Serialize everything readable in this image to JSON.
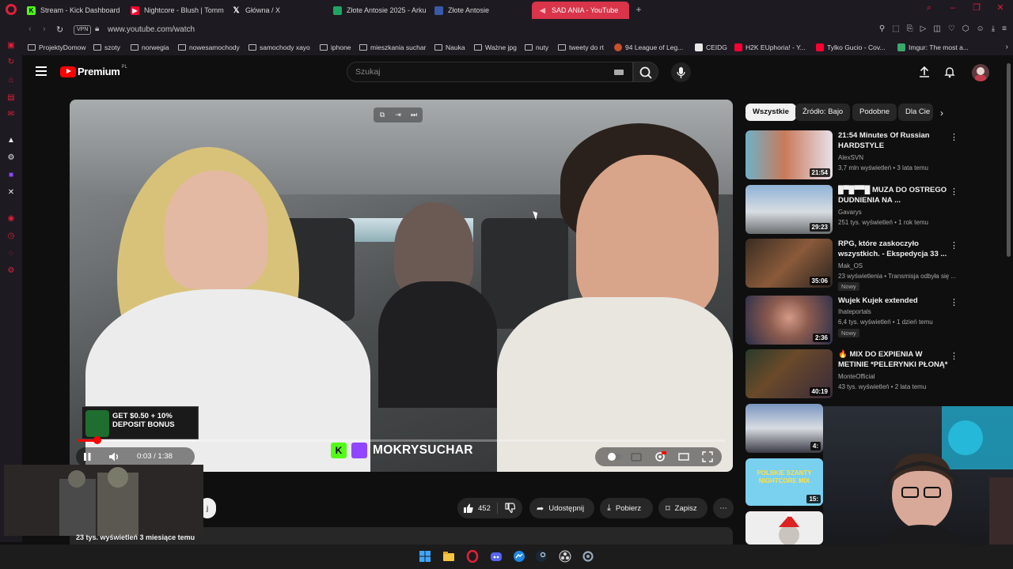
{
  "browser": {
    "tabs": [
      {
        "label": "Stream - Kick Dashboard",
        "favicon_color": "#53fc18"
      },
      {
        "label": "Nightcore - Blush | Tomm",
        "favicon_color": "#ff0033"
      },
      {
        "label": "Główna / X",
        "favicon_color": "#000000"
      },
      {
        "label": "Złote Antosie 2025 - Arku",
        "favicon_color": "#1fa463"
      },
      {
        "label": "Złote Antosie",
        "favicon_color": "#3a5aa8"
      },
      {
        "label": "SAD ANIA - YouTube",
        "favicon_color": "#ff0033"
      }
    ],
    "vpn_label": "VPN",
    "url": "www.youtube.com/watch",
    "bookmarks": [
      "ProjektyDomow",
      "szoty",
      "norwegia",
      "nowesamochody",
      "samochody xayo",
      "iphone",
      "mieszkania suchar",
      "Nauka",
      "Ważne jpg",
      "nuty",
      "tweety do rt",
      "94 League of Leg...",
      "CEIDG",
      "H2K EUphoria! - Y...",
      "Tylko Gucio - Cov...",
      "Imgur: The most a..."
    ]
  },
  "youtube": {
    "logo_text": "Premium",
    "logo_region": "PL",
    "search_placeholder": "Szukaj",
    "player": {
      "time": "0:03 / 1:38",
      "progress_fraction": 0.03,
      "watermark": "MOKRYSUCHAR",
      "ad_line1": "GET $0.50 + 10%",
      "ad_line2": "DEPOSIT BONUS"
    },
    "actions": {
      "likes": "452",
      "share": "Udostępnij",
      "download": "Pobierz",
      "save": "Zapisz",
      "subscribe_partial": "j"
    },
    "chips": [
      "Wszystkie",
      "Źródło: Bajo",
      "Podobne",
      "Dla Cie"
    ],
    "recommendations": [
      {
        "title": "21:54 Minutes Of Russian HARDSTYLE",
        "channel": "AlexSVN",
        "meta": "3,7 mln wyświetleń • 3 lata temu",
        "duration": "21:54",
        "badge": ""
      },
      {
        "title": "█▀█▀▀█ MUZA DO OSTREGO DUDNIENIA NA ...",
        "channel": "Gavarys",
        "meta": "251 tys. wyświetleń • 1 rok temu",
        "duration": "29:23",
        "badge": ""
      },
      {
        "title": "RPG, które zaskoczyło wszystkich. - Ekspedycja 33 ...",
        "channel": "Mak_OS",
        "meta": "23 wyświetlenia • Transmisja odbyła się ...",
        "duration": "35:06",
        "badge": "Nowy"
      },
      {
        "title": "Wujek Kujek extended",
        "channel": "Ihateportals",
        "meta": "6,4 tys. wyświetleń • 1 dzień temu",
        "duration": "2:36",
        "badge": "Nowy"
      },
      {
        "title": "🔥 MIX DO EXPIENIA  W METINIE *PELERYNKI PŁONĄ*",
        "channel": "MonteOfficial",
        "meta": "43 tys. wyświetleń • 2 lata temu",
        "duration": "40:19",
        "badge": ""
      }
    ],
    "extra_thumbs": [
      {
        "duration": "4:"
      },
      {
        "text": "POLSKIE SZANTY NIGHTCORE MIX",
        "duration": "15:"
      },
      {
        "duration": ""
      }
    ]
  },
  "overlay": {
    "pip_caption": "23 tys. wyświetleń  3 miesiące temu"
  }
}
